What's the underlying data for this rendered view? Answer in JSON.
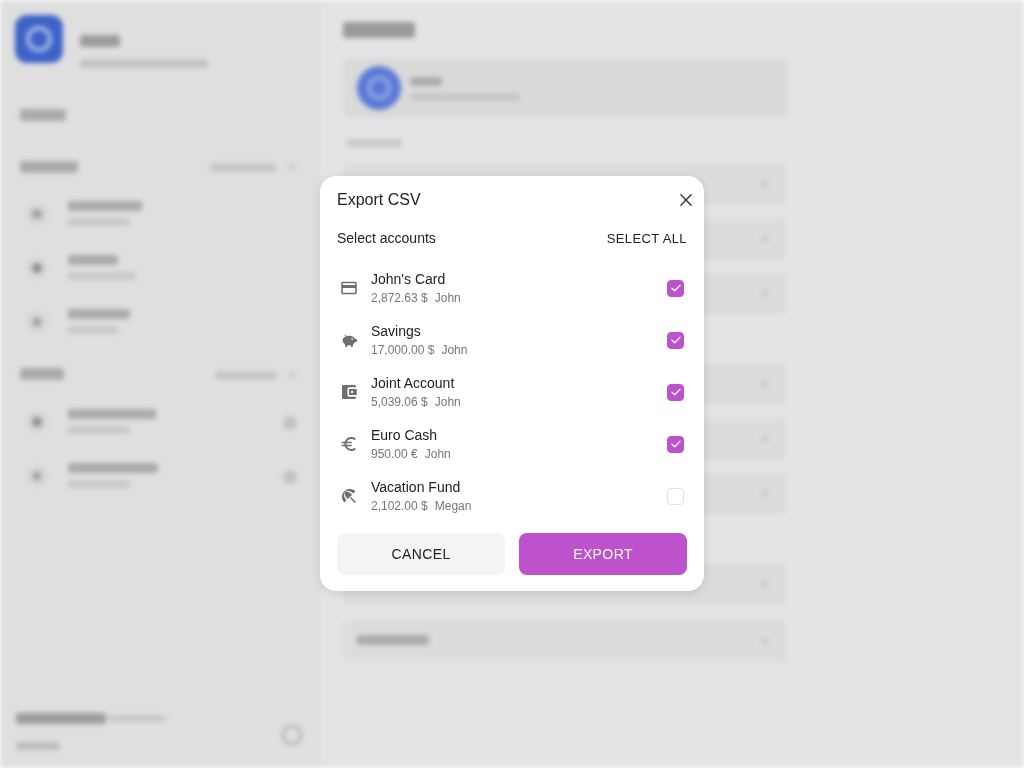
{
  "dialog": {
    "title": "Export CSV",
    "section_label": "Select accounts",
    "select_all": "SELECT ALL",
    "accounts": [
      {
        "kind": "card",
        "name": "John's Card",
        "balance": "2,872.63 $",
        "owner": "John",
        "checked": true
      },
      {
        "kind": "piggy",
        "name": "Savings",
        "balance": "17,000.00 $",
        "owner": "John",
        "checked": true
      },
      {
        "kind": "wallet",
        "name": "Joint Account",
        "balance": "5,039.06 $",
        "owner": "John",
        "checked": true
      },
      {
        "kind": "euro",
        "name": "Euro Cash",
        "balance": "950.00 €",
        "owner": "John",
        "checked": true
      },
      {
        "kind": "umbrella",
        "name": "Vacation Fund",
        "balance": "2,102.00 $",
        "owner": "Megan",
        "checked": false
      }
    ],
    "buttons": [
      {
        "kind": "cancel",
        "label": "CANCEL"
      },
      {
        "kind": "export",
        "label": "EXPORT"
      }
    ]
  }
}
